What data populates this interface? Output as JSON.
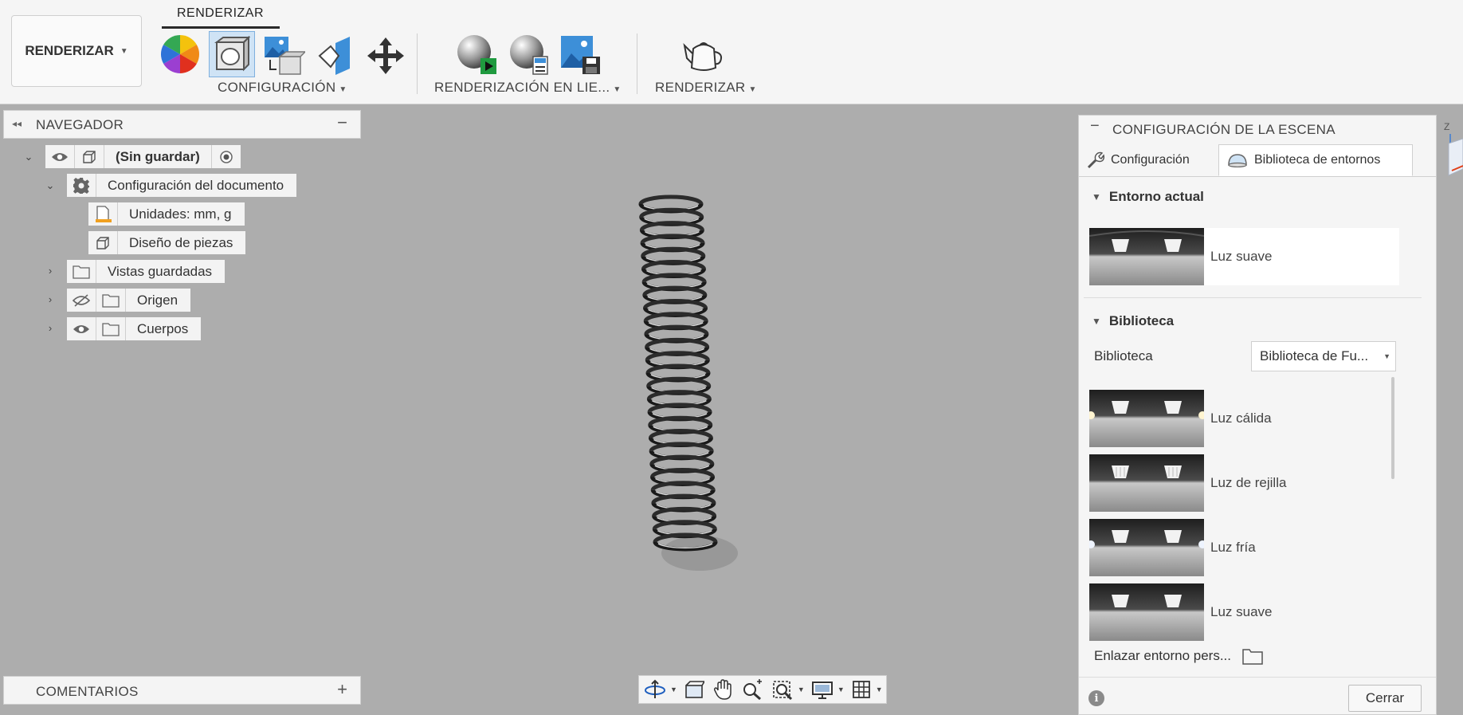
{
  "toolbar": {
    "workspace_button": "RENDERIZAR",
    "active_tab": "RENDERIZAR",
    "groups": {
      "configuracion": "CONFIGURACIÓN",
      "renderizacion_en_linea": "RENDERIZACIÓN EN LIE...",
      "renderizar": "RENDERIZAR"
    },
    "icons": [
      "appearance-icon",
      "scene-settings-icon",
      "texture-map-icon",
      "decal-icon",
      "move-icon",
      "in-canvas-render-icon",
      "in-canvas-render-settings-icon",
      "capture-image-icon",
      "render-teapot-icon"
    ]
  },
  "navigator": {
    "title": "NAVEGADOR",
    "root": "(Sin guardar)",
    "document_settings": "Configuración del documento",
    "units": "Unidades: mm, g",
    "design": "Diseño de piezas",
    "saved_views": "Vistas guardadas",
    "origin": "Origen",
    "bodies": "Cuerpos"
  },
  "comments": {
    "title": "COMENTARIOS"
  },
  "scene_settings": {
    "title": "CONFIGURACIÓN DE LA ESCENA",
    "tabs": {
      "settings": "Configuración",
      "environment_library": "Biblioteca de entornos"
    },
    "current_environment": {
      "heading": "Entorno actual",
      "name": "Luz suave"
    },
    "library": {
      "heading": "Biblioteca",
      "label": "Biblioteca",
      "selected": "Biblioteca de Fu...",
      "items": [
        "Luz cálida",
        "Luz de rejilla",
        "Luz fría",
        "Luz suave"
      ]
    },
    "link_custom": "Enlazar entorno pers...",
    "close_button": "Cerrar"
  },
  "viewcube": {
    "axis_label": "Z"
  }
}
